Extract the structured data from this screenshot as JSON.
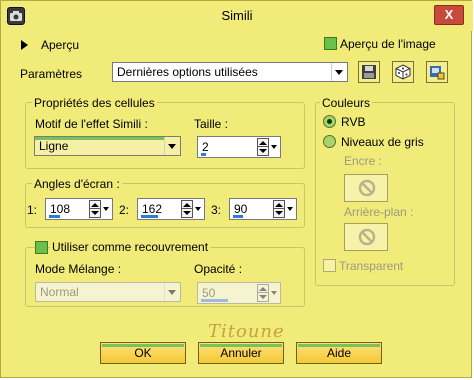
{
  "window": {
    "title": "Simili",
    "close_label": "X"
  },
  "header": {
    "preview_label": "Aperçu",
    "image_preview_label": "Aperçu de l'image",
    "image_preview_checked": true,
    "params_label": "Paramètres",
    "preset_value": "Dernières options utilisées"
  },
  "cells": {
    "title": "Propriétés des cellules",
    "pattern_label": "Motif de l'effet Simili :",
    "pattern_value": "Ligne",
    "size_label": "Taille :",
    "size_value": "2",
    "size_fraction": 0.1
  },
  "angles": {
    "title": "Angles d'écran :",
    "items": [
      {
        "label": "1:",
        "value": "108",
        "fraction": 0.3
      },
      {
        "label": "2:",
        "value": "162",
        "fraction": 0.45
      },
      {
        "label": "3:",
        "value": "90",
        "fraction": 0.25
      }
    ]
  },
  "overlay": {
    "use_label": "Utiliser comme recouvrement",
    "use_checked": true,
    "blend_label": "Mode Mélange :",
    "blend_value": "Normal",
    "opacity_label": "Opacité :",
    "opacity_value": "50",
    "opacity_fraction": 0.5
  },
  "colors": {
    "title": "Couleurs",
    "rgb_label": "RVB",
    "gray_label": "Niveaux de gris",
    "selected": "RVB",
    "ink_label": "Encre :",
    "background_label": "Arrière-plan :",
    "transparent_label": "Transparent",
    "transparent_checked": false
  },
  "signature": "Titoune",
  "buttons": {
    "ok": "OK",
    "cancel": "Annuler",
    "help": "Aide"
  },
  "colors_palette": {
    "dialog_bg": "#f1eb7a",
    "button_gold": "#f3c933",
    "accent_green": "#6dbf4b",
    "slider_blue": "#2e7ad6"
  }
}
